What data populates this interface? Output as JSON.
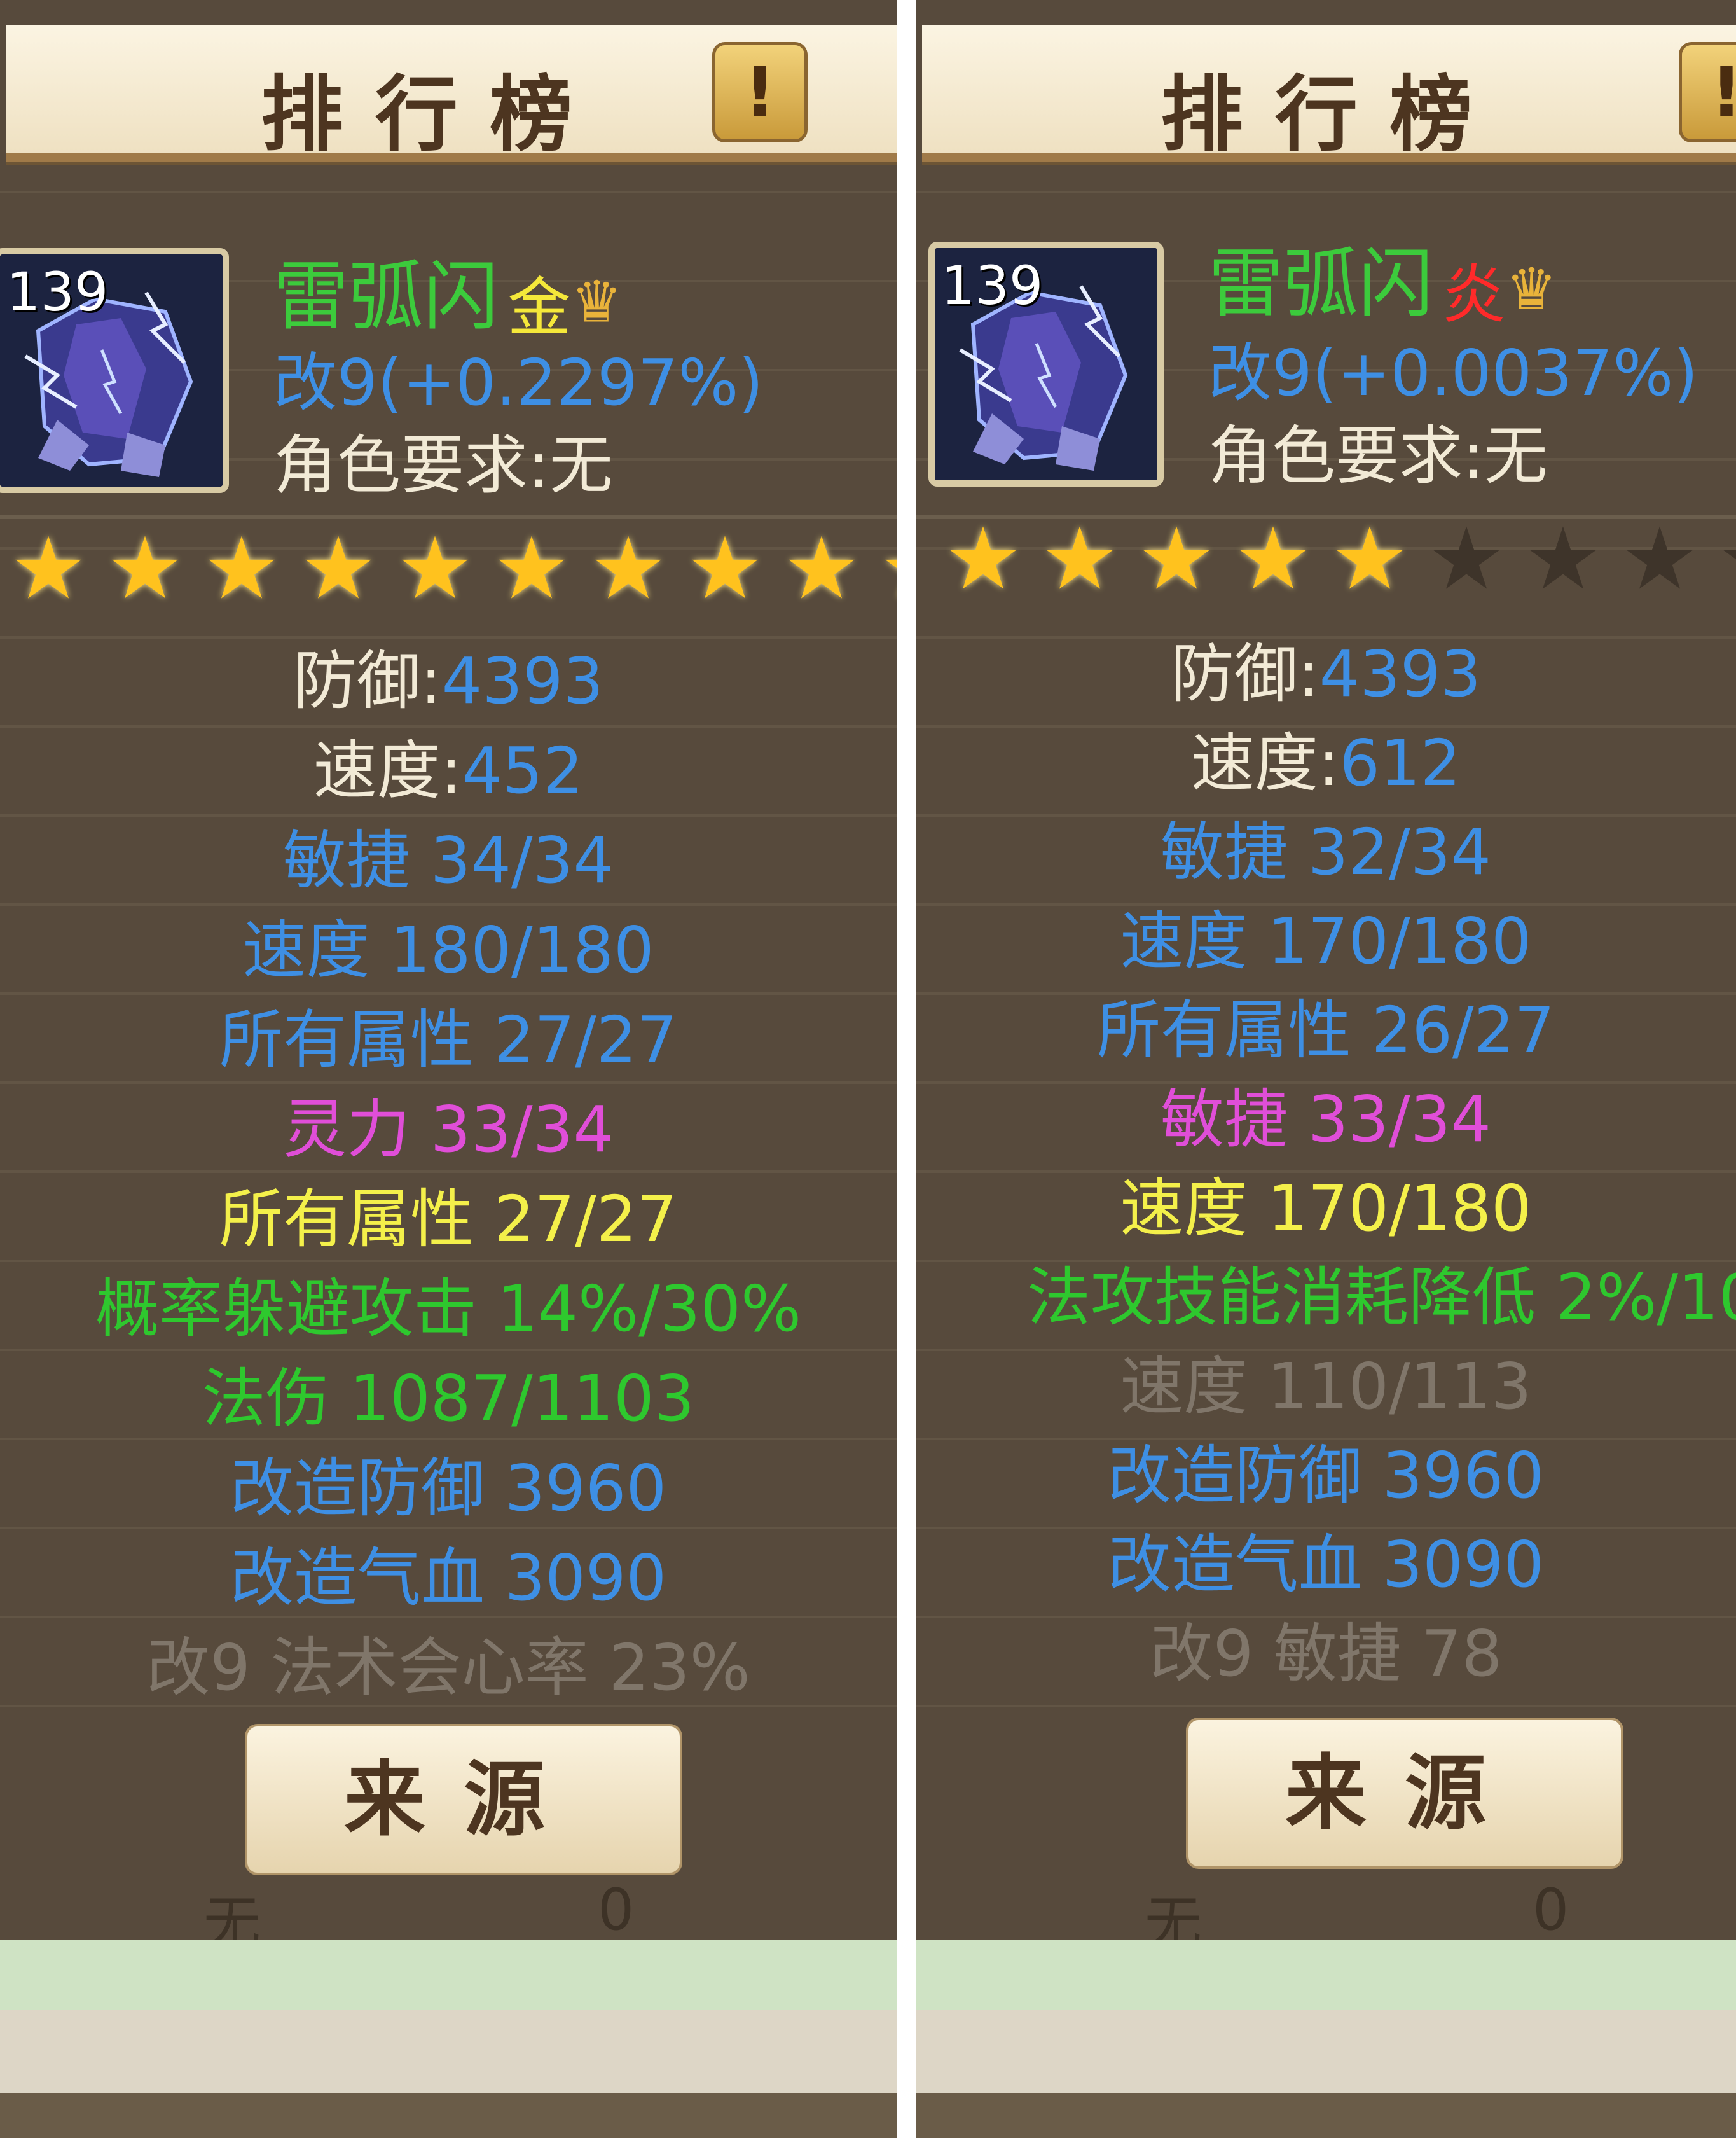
{
  "left": {
    "title": "排行榜",
    "info_button": "!",
    "item": {
      "level": "139",
      "name": "雷弧闪",
      "badge": "金",
      "refine": "改9(+0.2297%)",
      "requirement": "角色要求:无"
    },
    "stars": {
      "filled": 10,
      "total": 10
    },
    "stats": [
      {
        "text": "防御:4393",
        "parts": [
          {
            "t": "防御:",
            "c": "white"
          },
          {
            "t": "4393",
            "c": "blue"
          }
        ]
      },
      {
        "text": "速度:452",
        "parts": [
          {
            "t": "速度:",
            "c": "white"
          },
          {
            "t": "452",
            "c": "blue"
          }
        ]
      },
      {
        "text": "敏捷 34/34",
        "c": "blue"
      },
      {
        "text": "速度 180/180",
        "c": "blue"
      },
      {
        "text": "所有属性 27/27",
        "c": "blue"
      },
      {
        "text": "灵力 33/34",
        "c": "pink"
      },
      {
        "text": "所有属性 27/27",
        "c": "yellow"
      },
      {
        "text": "概率躲避攻击 14%/30%",
        "c": "green"
      },
      {
        "text": "法伤 1087/1103",
        "c": "green"
      },
      {
        "text": "改造防御 3960",
        "c": "blue"
      },
      {
        "text": "改造气血 3090",
        "c": "blue"
      },
      {
        "text": "改9 法术会心率 23%",
        "c": "grey"
      }
    ],
    "source_button": "来源",
    "footer_ghost": [
      "无",
      "0"
    ]
  },
  "right": {
    "title": "排行榜",
    "info_button": "!",
    "item": {
      "level": "139",
      "name": "雷弧闪",
      "badge": "炎",
      "refine": "改9(+0.0037%)",
      "requirement": "角色要求:无"
    },
    "stars": {
      "filled": 5,
      "total": 9
    },
    "stats": [
      {
        "text": "防御:4393",
        "parts": [
          {
            "t": "防御:",
            "c": "white"
          },
          {
            "t": "4393",
            "c": "blue"
          }
        ]
      },
      {
        "text": "速度:612",
        "parts": [
          {
            "t": "速度:",
            "c": "white"
          },
          {
            "t": "612",
            "c": "blue"
          }
        ]
      },
      {
        "text": "敏捷 32/34",
        "c": "blue"
      },
      {
        "text": "速度 170/180",
        "c": "blue"
      },
      {
        "text": "所有属性 26/27",
        "c": "blue"
      },
      {
        "text": "敏捷 33/34",
        "c": "pink"
      },
      {
        "text": "速度 170/180",
        "c": "yellow"
      },
      {
        "text": "法攻技能消耗降低 2%/10",
        "c": "green",
        "wide": true
      },
      {
        "text": "速度 110/113",
        "c": "grey"
      },
      {
        "text": "改造防御 3960",
        "c": "blue"
      },
      {
        "text": "改造气血 3090",
        "c": "blue"
      },
      {
        "text": "改9 敏捷 78",
        "c": "grey"
      }
    ],
    "source_button": "来源",
    "footer_ghost": [
      "无",
      "0"
    ]
  },
  "colors": {
    "white": "#f2ead6",
    "blue": "#3e8fe4",
    "pink": "#e04ed8",
    "yellow": "#f4f04a",
    "green": "#2ec82e",
    "grey": "#80766a",
    "star": "#ffc21e",
    "panel": "#574a3c"
  },
  "icons": {
    "crown": "crown-icon",
    "star": "star-icon",
    "item": "lightning-armor-icon"
  }
}
